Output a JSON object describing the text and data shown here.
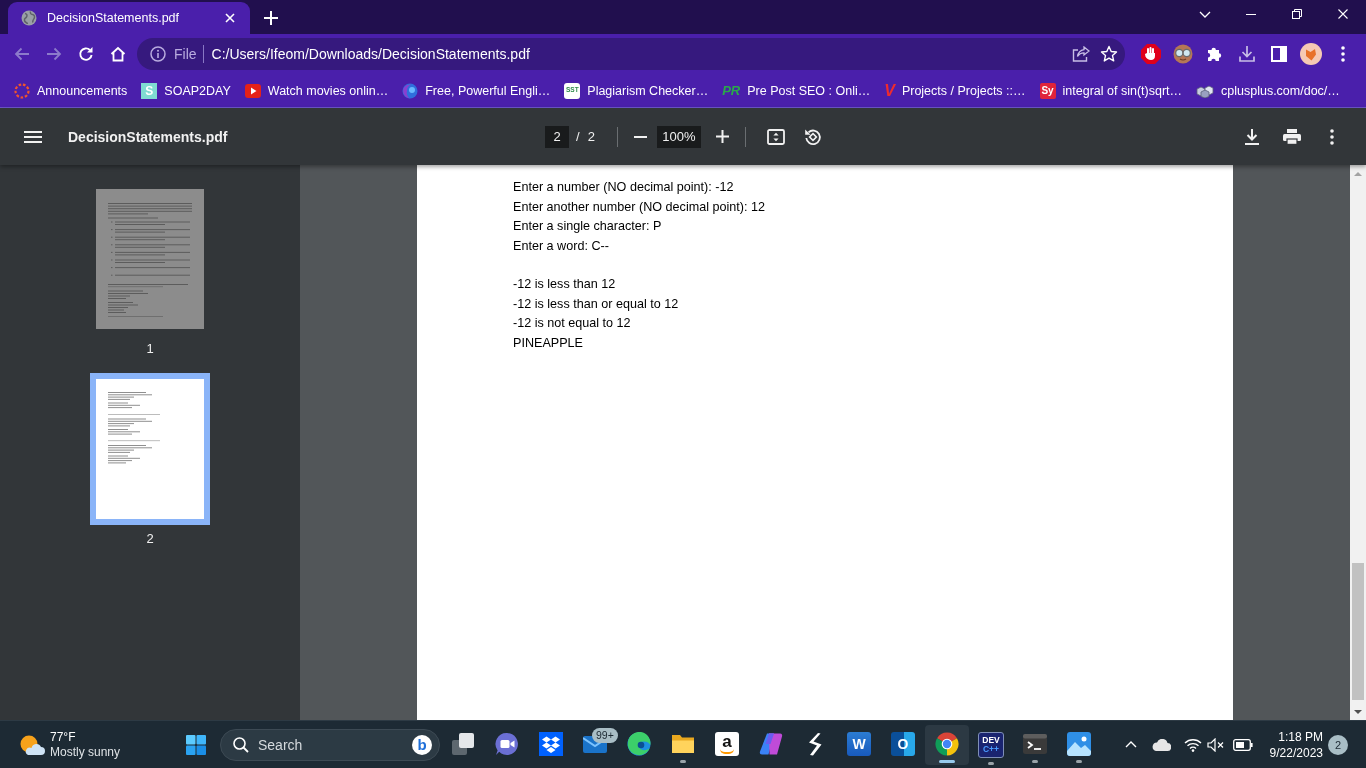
{
  "tabs": [
    {
      "title": "DecisionStatements.pdf",
      "selected": true
    }
  ],
  "navigation": [
    {
      "kind": "back",
      "disabled": true
    },
    {
      "kind": "forward",
      "disabled": true
    },
    {
      "kind": "reload",
      "disabled": false
    },
    {
      "kind": "home",
      "disabled": false
    }
  ],
  "address_bar": {
    "scheme": "File",
    "url": "C:/Users/Ifeom/Downloads/DecisionStatements.pdf"
  },
  "bookmarks": [
    {
      "kind": "ring",
      "label": "Announcements"
    },
    {
      "kind": "soap",
      "logo_text": "S",
      "label": "SOAP2DAY"
    },
    {
      "kind": "play",
      "label": "Watch movies onlin…"
    },
    {
      "kind": "orb",
      "label": "Free, Powerful Engli…"
    },
    {
      "kind": "sst",
      "logo_text": "SST",
      "label": "Plagiarism Checker…"
    },
    {
      "kind": "seo",
      "logo_text": "PR",
      "label": "Pre Post SEO : Onli…"
    },
    {
      "kind": "vmark",
      "logo_text": "V",
      "label": "Projects / Projects ::…"
    },
    {
      "kind": "sy",
      "logo_text": "Sy",
      "label": "integral of sin(t)sqrt…"
    },
    {
      "kind": "cubes",
      "label": "cplusplus.com/doc/…"
    }
  ],
  "pdf": {
    "title": "DecisionStatements.pdf",
    "page": "2",
    "separator": "/",
    "page_count": "2",
    "zoom": "100%",
    "thumbnails": [
      {
        "label": "1",
        "selected": false
      },
      {
        "label": "2",
        "selected": true
      }
    ],
    "paragraphs": [
      {
        "lines": [
          "Enter a number (NO decimal point): -12",
          "Enter another number (NO decimal point): 12",
          "Enter a single character: P",
          "Enter a word: C--"
        ]
      },
      {
        "lines": [
          "-12 is less than 12",
          "-12 is less than or equal to 12",
          "-12 is not equal to 12",
          "PINEAPPLE"
        ]
      }
    ]
  },
  "taskbar": {
    "weather": {
      "temperature": "77°F",
      "condition": "Mostly sunny"
    },
    "search": {
      "label": "Search",
      "logo_text": "b"
    },
    "apps": [
      {
        "kind": "squares",
        "running": false,
        "active": false
      },
      {
        "kind": "meet",
        "running": false,
        "active": false
      },
      {
        "kind": "dropbox",
        "running": false,
        "active": false
      },
      {
        "kind": "mail",
        "badge": "99+",
        "running": false,
        "active": false
      },
      {
        "kind": "edge",
        "running": false,
        "active": false
      },
      {
        "kind": "folder",
        "running": true,
        "active": false
      },
      {
        "kind": "amazon",
        "logo_text": "a",
        "running": false,
        "active": false
      },
      {
        "kind": "copilot",
        "running": false,
        "active": false
      },
      {
        "kind": "zigzag",
        "running": false,
        "active": false
      },
      {
        "kind": "word",
        "logo_text": "W",
        "running": false,
        "active": false
      },
      {
        "kind": "outlook",
        "logo_text": "O",
        "running": false,
        "active": false
      },
      {
        "kind": "chrome",
        "running": true,
        "active": true
      },
      {
        "kind": "devcpp",
        "logo_text": "DEV",
        "logo_subtext": "C++",
        "running": true,
        "active": false
      },
      {
        "kind": "terminal",
        "running": true,
        "active": false
      },
      {
        "kind": "photos",
        "running": true,
        "active": false
      }
    ],
    "clock": {
      "time": "1:18 PM",
      "date": "9/22/2023"
    },
    "notifications": "2"
  }
}
